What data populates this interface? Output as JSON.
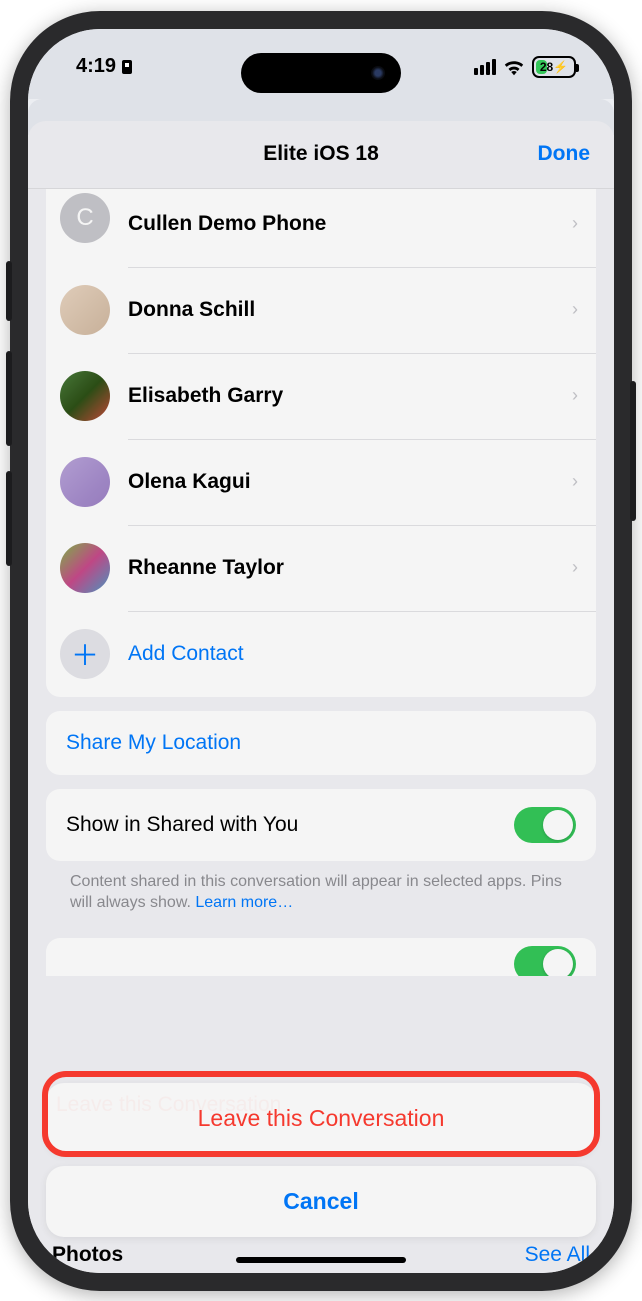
{
  "status": {
    "time": "4:19",
    "battery_pct": "28",
    "battery_charging": true
  },
  "nav": {
    "title": "Elite iOS 18",
    "done": "Done"
  },
  "members": [
    {
      "name": "Cullen Demo Phone",
      "initial": "C",
      "avatar_kind": "initial"
    },
    {
      "name": "Donna Schill",
      "avatar_kind": "photo1"
    },
    {
      "name": "Elisabeth Garry",
      "avatar_kind": "photo2"
    },
    {
      "name": "Olena Kagui",
      "avatar_kind": "photo3"
    },
    {
      "name": "Rheanne Taylor",
      "avatar_kind": "photo4"
    }
  ],
  "actions": {
    "add_contact": "Add Contact",
    "share_location": "Share My Location",
    "shared_with_you_label": "Show in Shared with You",
    "shared_with_you_on": true,
    "shared_footer": "Content shared in this conversation will appear in selected apps. Pins will always show. ",
    "learn_more": "Learn more…"
  },
  "sheet": {
    "leave": "Leave this Conversation",
    "cancel": "Cancel",
    "behind_text": "Leave this Conversation"
  },
  "bottom": {
    "photos": "Photos",
    "see_all": "See All"
  },
  "colors": {
    "accent": "#007AFF",
    "destructive": "#FF3B30",
    "toggle_on": "#34C759"
  }
}
